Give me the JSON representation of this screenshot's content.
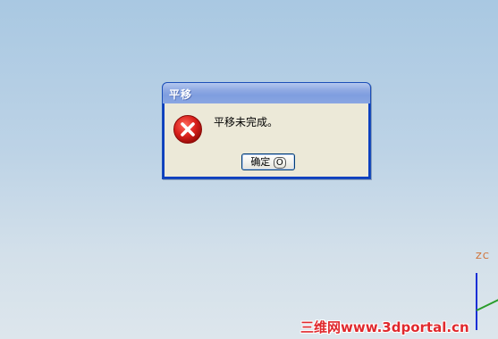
{
  "dialog": {
    "title": "平移",
    "message": "平移未完成。",
    "ok_label": "确定",
    "ok_mnemonic": "O",
    "icon": "error-icon"
  },
  "viewport": {
    "axis_label": "ZC",
    "watermark": "三维网www.3dportal.cn"
  },
  "colors": {
    "title_bar": "#8aa6e2",
    "dialog_bg": "#ece9d8",
    "error_red": "#d9201b",
    "axis_z": "#1a2fd6",
    "axis_x": "#2b9d2b",
    "axis_label": "#d06a2a",
    "watermark": "#e0292d"
  }
}
